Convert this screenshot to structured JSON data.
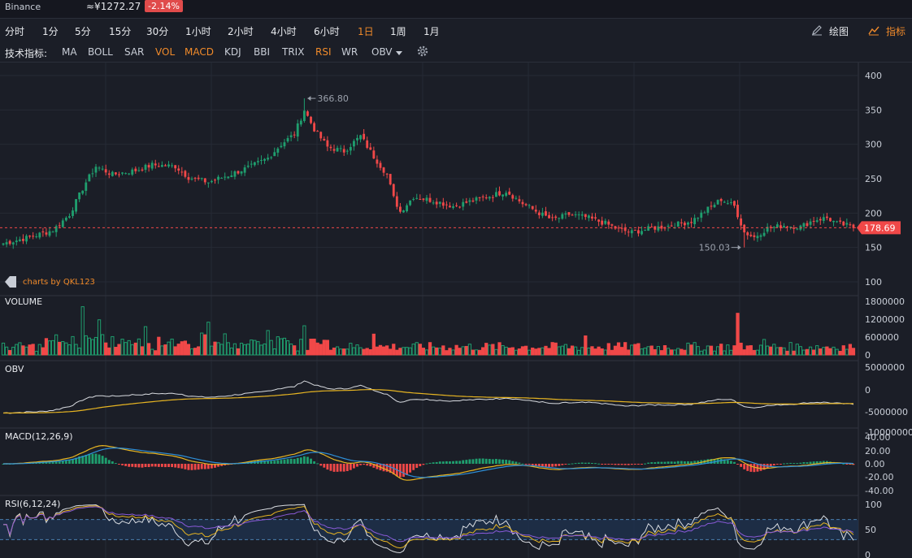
{
  "header": {
    "exchange": "Binance",
    "price_cny": "≈¥1272.27",
    "change": "-2.14%"
  },
  "timeframes": [
    "分时",
    "1分",
    "5分",
    "15分",
    "30分",
    "1小时",
    "2小时",
    "4小时",
    "6小时",
    "1日",
    "1周",
    "1月"
  ],
  "active_timeframe": "1日",
  "tools": {
    "draw": "绘图",
    "indicator": "指标"
  },
  "indicators": {
    "label": "技术指标:",
    "items": [
      "MA",
      "BOLL",
      "SAR",
      "VOL",
      "MACD",
      "KDJ",
      "BBI",
      "TRIX",
      "RSI",
      "WR",
      "OBV"
    ],
    "active": [
      "VOL",
      "MACD",
      "RSI"
    ]
  },
  "colors": {
    "up": "#1f9e6e",
    "down": "#f04848",
    "accent": "#f08a2a",
    "line_white": "#d8dbe0",
    "line_yellow": "#e6b422",
    "line_blue": "#2e8fd8",
    "line_purple": "#8a5ad8"
  },
  "watermark": "charts by QKL123",
  "chart_data": [
    {
      "type": "candlestick",
      "ylim": [
        100,
        400
      ],
      "yticks": [
        100,
        150,
        200,
        250,
        300,
        350,
        400
      ],
      "last_price": "178.69",
      "high_annotation": "366.80",
      "low_annotation": "150.03",
      "close_anchors": [
        [
          0,
          156
        ],
        [
          8,
          165
        ],
        [
          15,
          175
        ],
        [
          20,
          198
        ],
        [
          25,
          245
        ],
        [
          28,
          268
        ],
        [
          33,
          256
        ],
        [
          40,
          262
        ],
        [
          45,
          270
        ],
        [
          52,
          268
        ],
        [
          56,
          252
        ],
        [
          62,
          245
        ],
        [
          68,
          255
        ],
        [
          75,
          268
        ],
        [
          80,
          280
        ],
        [
          84,
          300
        ],
        [
          88,
          315
        ],
        [
          91,
          350
        ],
        [
          94,
          322
        ],
        [
          98,
          296
        ],
        [
          103,
          290
        ],
        [
          108,
          312
        ],
        [
          112,
          282
        ],
        [
          116,
          256
        ],
        [
          118,
          222
        ],
        [
          120,
          202
        ],
        [
          124,
          224
        ],
        [
          130,
          218
        ],
        [
          136,
          210
        ],
        [
          142,
          218
        ],
        [
          148,
          226
        ],
        [
          152,
          232
        ],
        [
          157,
          214
        ],
        [
          162,
          200
        ],
        [
          166,
          190
        ],
        [
          171,
          198
        ],
        [
          176,
          194
        ],
        [
          182,
          185
        ],
        [
          186,
          176
        ],
        [
          190,
          172
        ],
        [
          196,
          178
        ],
        [
          202,
          182
        ],
        [
          208,
          188
        ],
        [
          213,
          206
        ],
        [
          217,
          220
        ],
        [
          221,
          210
        ],
        [
          224,
          172
        ],
        [
          227,
          165
        ],
        [
          231,
          178
        ],
        [
          236,
          182
        ],
        [
          241,
          180
        ],
        [
          245,
          190
        ],
        [
          249,
          193
        ],
        [
          252,
          185
        ],
        [
          255,
          182
        ],
        [
          257,
          179
        ]
      ]
    },
    {
      "type": "bar",
      "title": "VOLUME",
      "ylim": [
        0,
        1800000
      ],
      "yticks": [
        0,
        600000,
        1200000,
        1800000
      ]
    },
    {
      "type": "line",
      "title": "OBV",
      "yticks": [
        "5000000",
        "0",
        "-5000000",
        "-10000000"
      ],
      "series_colors": [
        "#d8dbe0",
        "#e6b422"
      ]
    },
    {
      "type": "line",
      "title": "MACD(12,26,9)",
      "yticks": [
        "40.00",
        "20.00",
        "0.00",
        "-20.00",
        "-40.00"
      ],
      "series_colors": [
        "#e6b422",
        "#2e8fd8"
      ]
    },
    {
      "type": "line",
      "title": "RSI(6,12,24)",
      "ylim": [
        0,
        100
      ],
      "yticks": [
        "100",
        "50",
        "0"
      ],
      "band": [
        30,
        70
      ],
      "series_colors": [
        "#d8dbe0",
        "#e6b422",
        "#8a5ad8"
      ]
    }
  ]
}
